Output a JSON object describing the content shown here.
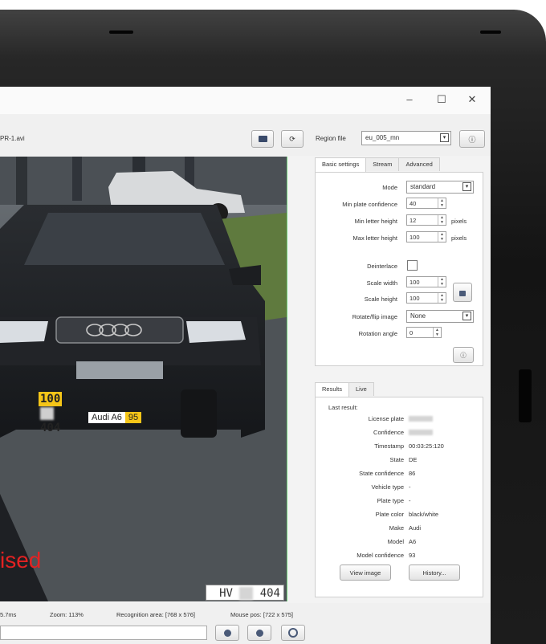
{
  "window": {
    "file_name": "PR-1.avi",
    "controls": [
      "–",
      "☐",
      "✕"
    ]
  },
  "toolbar": {
    "region_label": "Region file",
    "region_value": "eu_005_mn"
  },
  "video": {
    "overlay_text": "ised",
    "plate_country": "DE",
    "plate_conf_1": "100",
    "plate_text": "HV",
    "plate_number": "404",
    "plate_conf_2": "100",
    "make_model": "Audi A6",
    "make_model_conf": "95",
    "crop_text": "HV",
    "crop_number": "404"
  },
  "settings": {
    "tabs": [
      "Basic settings",
      "Stream",
      "Advanced"
    ],
    "mode_label": "Mode",
    "mode_value": "standard",
    "min_conf_label": "Min plate confidence",
    "min_conf_value": "40",
    "min_letter_label": "Min letter height",
    "min_letter_value": "12",
    "max_letter_label": "Max letter height",
    "max_letter_value": "100",
    "pixels": "pixels",
    "deinterlace_label": "Deinterlace",
    "scale_width_label": "Scale width",
    "scale_width_value": "100",
    "scale_height_label": "Scale height",
    "scale_height_value": "100",
    "rotate_label": "Rotate/flip image",
    "rotate_value": "None",
    "rotation_label": "Rotation angle",
    "rotation_value": "0"
  },
  "results": {
    "tabs": [
      "Results",
      "Live"
    ],
    "last_result": "Last result:",
    "rows": [
      {
        "label": "License plate",
        "value": ""
      },
      {
        "label": "Confidence",
        "value": ""
      },
      {
        "label": "Timestamp",
        "value": "00:03:25:120"
      },
      {
        "label": "State",
        "value": "DE"
      },
      {
        "label": "State confidence",
        "value": "86"
      },
      {
        "label": "Vehicle type",
        "value": "-"
      },
      {
        "label": "Plate type",
        "value": "-"
      },
      {
        "label": "Plate color",
        "value": "black/white"
      },
      {
        "label": "Make",
        "value": "Audi"
      },
      {
        "label": "Model",
        "value": "A6"
      },
      {
        "label": "Model confidence",
        "value": "93"
      }
    ],
    "view_image": "View image",
    "history": "History..."
  },
  "status": {
    "time": "5.7ms",
    "zoom": "Zoom: 113%",
    "recognition": "Recognition area: [768 x 576]",
    "mouse": "Mouse pos: [722 x 575]"
  }
}
